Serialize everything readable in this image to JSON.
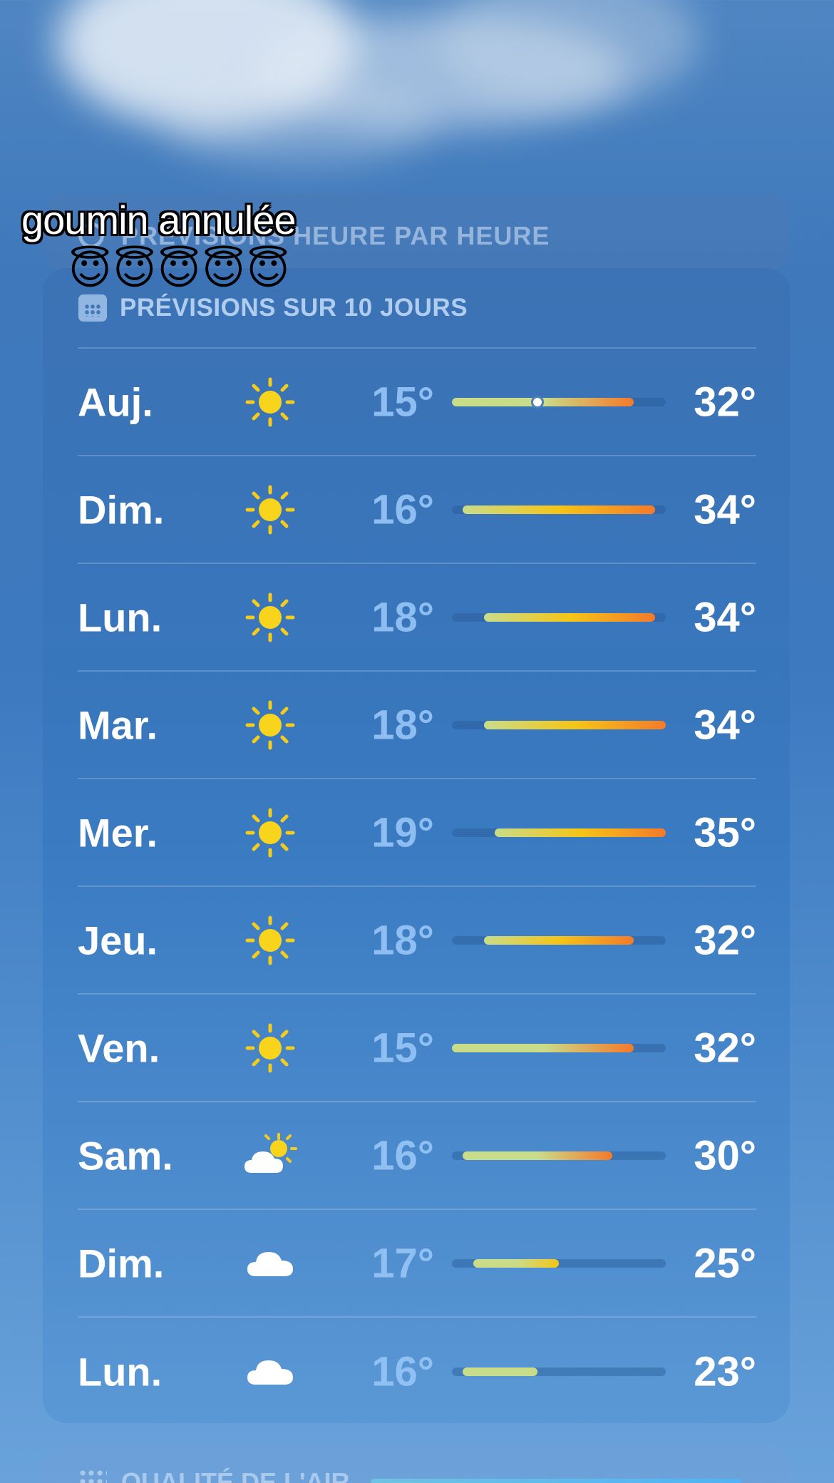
{
  "caption": {
    "text": "goumin annulée",
    "emojis": "😇😇😇😇😇"
  },
  "hourly_card": {
    "title": "PRÉVISIONS HEURE PAR HEURE",
    "icon": "clock-icon"
  },
  "forecast": {
    "title": "PRÉVISIONS SUR 10 JOURS",
    "icon": "calendar-icon",
    "range_low": 15,
    "range_high": 35,
    "days": [
      {
        "day": "Auj.",
        "icon": "sun",
        "low": "15°",
        "high": "32°",
        "low_val": 15,
        "high_val": 32,
        "current_val": 23
      },
      {
        "day": "Dim.",
        "icon": "sun",
        "low": "16°",
        "high": "34°",
        "low_val": 16,
        "high_val": 34
      },
      {
        "day": "Lun.",
        "icon": "sun",
        "low": "18°",
        "high": "34°",
        "low_val": 18,
        "high_val": 34
      },
      {
        "day": "Mar.",
        "icon": "sun",
        "low": "18°",
        "high": "34°",
        "low_val": 18,
        "high_val": 35
      },
      {
        "day": "Mer.",
        "icon": "sun",
        "low": "19°",
        "high": "35°",
        "low_val": 19,
        "high_val": 35
      },
      {
        "day": "Jeu.",
        "icon": "sun",
        "low": "18°",
        "high": "32°",
        "low_val": 18,
        "high_val": 32
      },
      {
        "day": "Ven.",
        "icon": "sun",
        "low": "15°",
        "high": "32°",
        "low_val": 15,
        "high_val": 32
      },
      {
        "day": "Sam.",
        "icon": "partly-cloudy",
        "low": "16°",
        "high": "30°",
        "low_val": 16,
        "high_val": 30
      },
      {
        "day": "Dim.",
        "icon": "cloud",
        "low": "17°",
        "high": "25°",
        "low_val": 17,
        "high_val": 25
      },
      {
        "day": "Lun.",
        "icon": "cloud",
        "low": "16°",
        "high": "23°",
        "low_val": 16,
        "high_val": 23
      }
    ]
  },
  "air_card": {
    "title": "QUALITÉ DE L'AIR",
    "icon": "air-quality-icon"
  },
  "colors": {
    "cool": "#c9dc8a",
    "warm": "#f5c518",
    "hot": "#f47a2a"
  }
}
